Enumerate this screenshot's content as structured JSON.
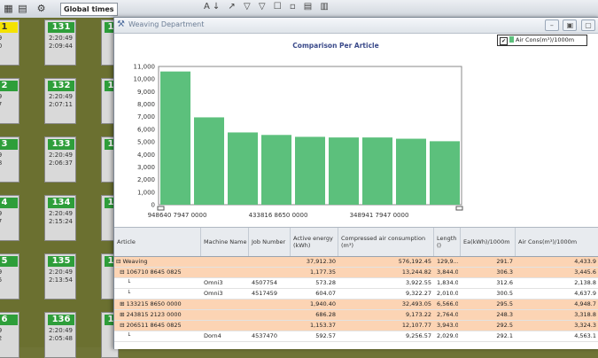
{
  "toolbar": {
    "field": "Global times"
  },
  "tiles": [
    {
      "num": "1",
      "t1": ":49",
      "t2": ":00",
      "yellow": true
    },
    {
      "num": "131",
      "t1": "2:20:49",
      "t2": "2:09:44"
    },
    {
      "num": "2",
      "t1": ":49",
      "t2": ":17"
    },
    {
      "num": "132",
      "t1": "2:20:49",
      "t2": "2:07:11"
    },
    {
      "num": "3",
      "t1": ":49",
      "t2": ":18"
    },
    {
      "num": "133",
      "t1": "2:20:49",
      "t2": "2:06:37"
    },
    {
      "num": "4",
      "t1": ":49",
      "t2": ":27"
    },
    {
      "num": "134",
      "t1": "2:20:49",
      "t2": "2:15:24"
    },
    {
      "num": "5",
      "t1": ":49",
      "t2": ":55"
    },
    {
      "num": "135",
      "t1": "2:20:49",
      "t2": "2:13:54"
    },
    {
      "num": "6",
      "t1": ":49",
      "t2": ":12"
    },
    {
      "num": "136",
      "t1": "2:20:49",
      "t2": "2:05:48"
    }
  ],
  "window": {
    "title": "Weaving Department",
    "legend": "Air Cons(m³)/1000m"
  },
  "chart_data": {
    "type": "bar",
    "title": "Comparison Per Article",
    "categories": [
      "948640 7947 0000",
      "",
      "",
      "433816 8650 0000",
      "",
      "",
      "348941 7947 0000",
      "",
      ""
    ],
    "tick_labels": [
      "948640 7947 0000",
      "433816 8650 0000",
      "348941 7947 0000"
    ],
    "values": [
      10600,
      6950,
      5750,
      5550,
      5400,
      5350,
      5350,
      5250,
      5050
    ],
    "ylim": [
      0,
      11000
    ],
    "yticks": [
      "0",
      "1,000",
      "2,000",
      "3,000",
      "4,000",
      "5,000",
      "6,000",
      "7,000",
      "8,000",
      "9,000",
      "10,000",
      "11,000"
    ],
    "series": [
      {
        "name": "Air Cons(m³)/1000m",
        "color": "#5cc07c"
      }
    ]
  },
  "table": {
    "headers": [
      "Article",
      "Machine Name",
      "Job Number",
      "Active energy (kWh)",
      "Compressed air consumption (m³)",
      "Length ()",
      "Ea(kWh)/1000m",
      "Air Cons(m³)/1000m"
    ],
    "rows": [
      {
        "peach": true,
        "tree": "⊟ Weaving",
        "cells": [
          "",
          "",
          "37,912.30",
          "576,192.45",
          "129,9...",
          "291.7",
          "4,433.9"
        ]
      },
      {
        "peach": true,
        "tree": "  ⊟ 106710 8645 0825",
        "cells": [
          "",
          "",
          "1,177.35",
          "13,244.82",
          "3,844.0",
          "306.3",
          "3,445.6"
        ]
      },
      {
        "peach": false,
        "tree": "      └",
        "cells": [
          "Omni3",
          "4507754",
          "573.28",
          "3,922.55",
          "1,834.0",
          "312.6",
          "2,138.8"
        ]
      },
      {
        "peach": false,
        "tree": "      └",
        "cells": [
          "Omni3",
          "4517459",
          "604.07",
          "9,322.27",
          "2,010.0",
          "300.5",
          "4,637.9"
        ]
      },
      {
        "peach": true,
        "tree": "  ⊞ 133215 8650 0000",
        "cells": [
          "",
          "",
          "1,940.40",
          "32,493.05",
          "6,566.0",
          "295.5",
          "4,948.7"
        ]
      },
      {
        "peach": true,
        "tree": "  ⊞ 243815 2123 0000",
        "cells": [
          "",
          "",
          "686.28",
          "9,173.22",
          "2,764.0",
          "248.3",
          "3,318.8"
        ]
      },
      {
        "peach": true,
        "tree": "  ⊟ 206511 8645 0825",
        "cells": [
          "",
          "",
          "1,153.37",
          "12,107.77",
          "3,943.0",
          "292.5",
          "3,324.3"
        ]
      },
      {
        "peach": false,
        "tree": "      └",
        "cells": [
          "Dorn4",
          "4537470",
          "592.57",
          "9,256.57",
          "2,029.0",
          "292.1",
          "4,563.1"
        ]
      }
    ]
  }
}
